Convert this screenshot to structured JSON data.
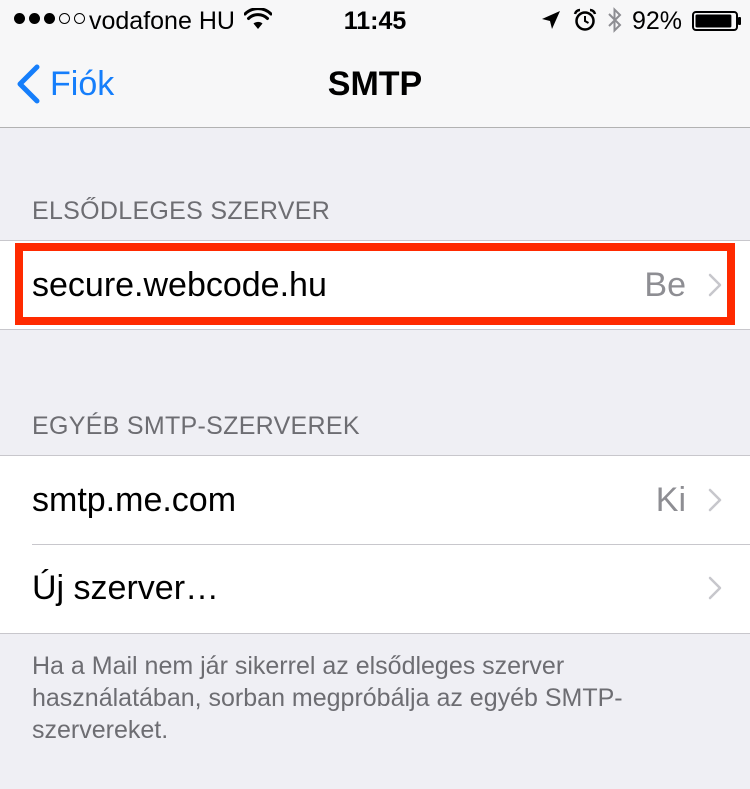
{
  "status_bar": {
    "carrier": "vodafone HU",
    "time": "11:45",
    "battery_percent": "92%",
    "signal_bars": 3,
    "signal_total": 5,
    "battery_level": 0.92,
    "icons": [
      "signal-dots-icon",
      "wifi-icon",
      "location-arrow-icon",
      "alarm-clock-icon",
      "bluetooth-icon",
      "battery-icon"
    ]
  },
  "nav": {
    "back_label": "Fiók",
    "title": "SMTP"
  },
  "primary_section": {
    "header": "ELSŐDLEGES SZERVER",
    "server": {
      "name": "secure.webcode.hu",
      "status": "Be"
    }
  },
  "other_section": {
    "header": "EGYÉB SMTP-SZERVEREK",
    "servers": [
      {
        "name": "smtp.me.com",
        "status": "Ki"
      }
    ],
    "add_server_label": "Új szerver…"
  },
  "footer_text": "Ha a Mail nem jár sikerrel az elsődleges szerver használatában, sorban megpróbálja az egyéb SMTP-szervereket.",
  "colors": {
    "accent": "#157efb",
    "background": "#efeff4",
    "highlight": "#ff2a00",
    "secondary_text": "#8e8e93"
  }
}
